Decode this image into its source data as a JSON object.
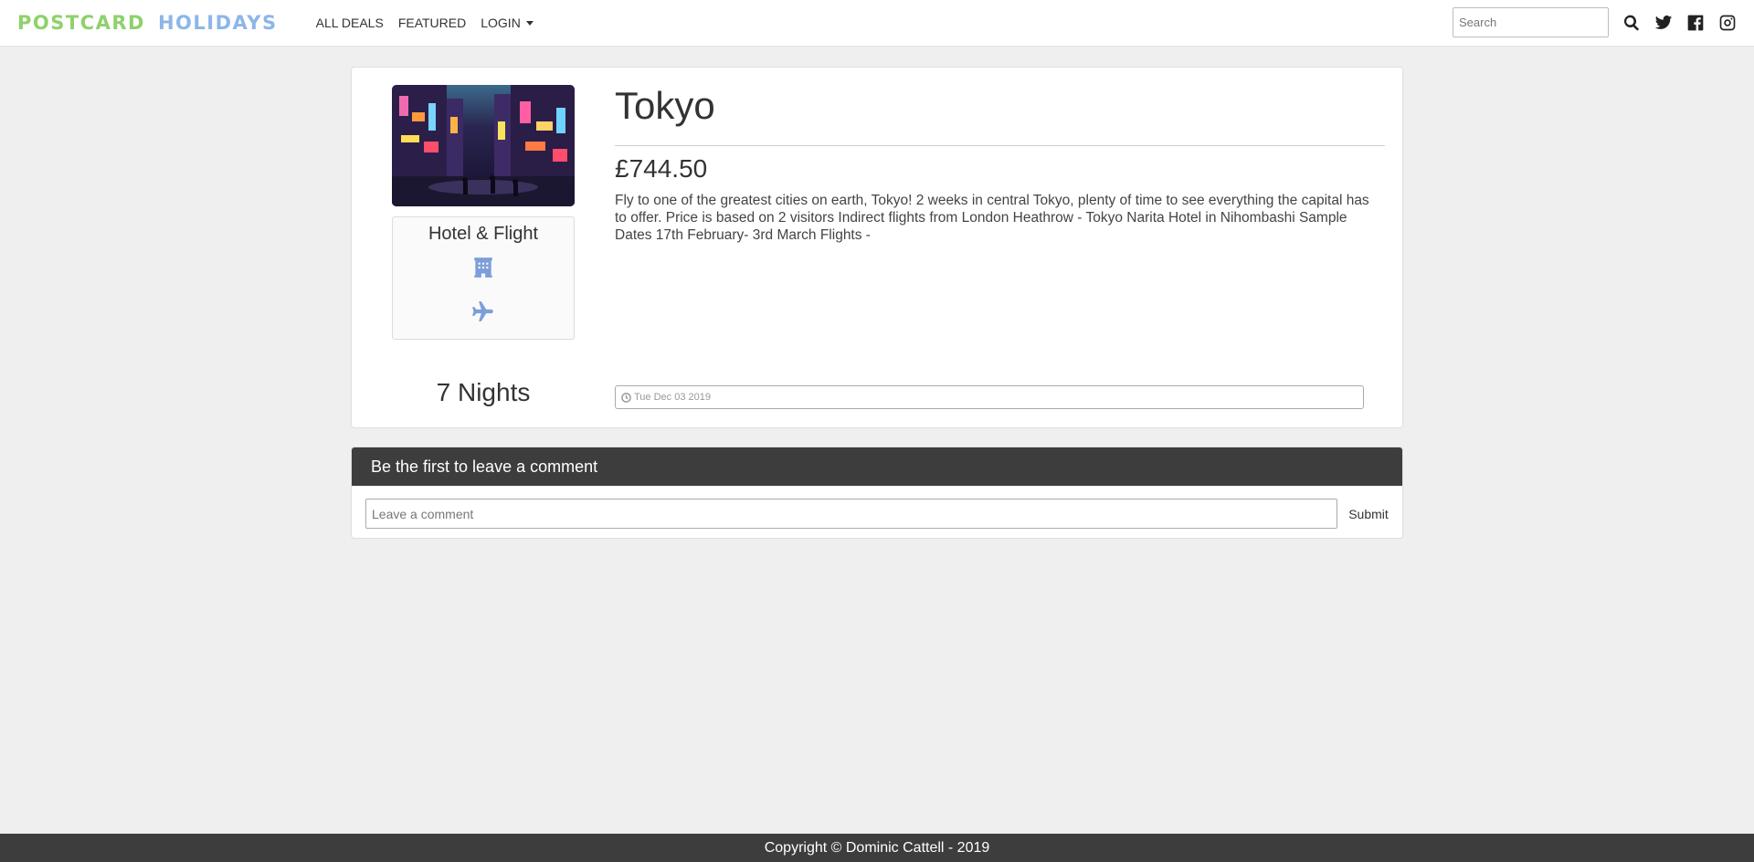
{
  "brand": {
    "word1": "POSTCARD",
    "word2": "HOLIDAYS"
  },
  "nav": {
    "links": [
      "ALL DEALS",
      "FEATURED",
      "LOGIN"
    ],
    "search_placeholder": "Search"
  },
  "icons": {
    "search": "search-icon",
    "twitter": "twitter-icon",
    "facebook": "facebook-icon",
    "instagram": "instagram-icon",
    "hotel": "hotel-icon",
    "plane": "plane-icon",
    "clock": "clock-icon"
  },
  "deal": {
    "title": "Tokyo",
    "price": "£744.50",
    "description": "Fly to one of the greatest cities on earth, Tokyo! 2 weeks in central Tokyo, plenty of time to see everything the capital has to offer. Price is based on 2 visitors Indirect flights from London Heathrow - Tokyo Narita Hotel in Nihombashi Sample Dates 17th February- 3rd March Flights -",
    "type": "Hotel & Flight",
    "nights": "7 Nights",
    "date": "Tue Dec 03 2019"
  },
  "comments": {
    "header": "Be the first to leave a comment",
    "placeholder": "Leave a comment",
    "submit": "Submit"
  },
  "footer": {
    "text": "Copyright © Dominic Cattell - 2019"
  },
  "colors": {
    "brand_green": "#8fd16c",
    "brand_blue": "#8db6e8",
    "icon_blue": "#7c9fd9",
    "dark_bar": "#3d3d3d",
    "page_bg": "#efefef"
  }
}
